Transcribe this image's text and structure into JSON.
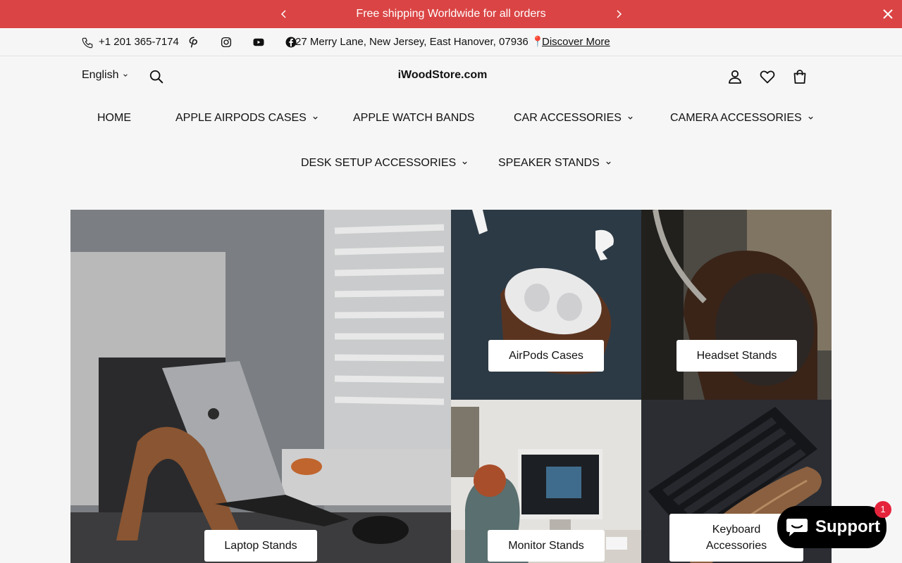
{
  "colors": {
    "announce_bg": "#db4444",
    "support_bg": "#000000",
    "badge": "#e5243b"
  },
  "announcement": {
    "text": "Free shipping Worldwide for all orders",
    "prev_icon": "chevron-left-icon",
    "next_icon": "chevron-right-icon",
    "close_icon": "close-icon"
  },
  "infobar": {
    "phone": "+1 201 365-7174",
    "socials": [
      "pinterest-icon",
      "instagram-icon",
      "youtube-icon",
      "facebook-icon"
    ],
    "address": "27 Merry Lane, New Jersey, East Hanover, 07936 📍",
    "discover_label": "Discover More"
  },
  "header": {
    "language": "English",
    "logo": "iWoodStore.com",
    "icons": [
      "account-icon",
      "wishlist-icon",
      "cart-icon"
    ]
  },
  "nav": {
    "home": "HOME",
    "airpods": "APPLE AIRPODS CASES",
    "watch": "APPLE WATCH BANDS",
    "car": "CAR ACCESSORIES",
    "camera": "CAMERA ACCESSORIES",
    "desk": "DESK SETUP ACCESSORIES",
    "speaker": "SPEAKER STANDS"
  },
  "collections": {
    "laptop": "Laptop Stands",
    "airpods": "AirPods Cases",
    "headset": "Headset Stands",
    "monitor": "Monitor Stands",
    "keyboard": "Keyboard Accessories"
  },
  "support": {
    "label": "Support",
    "badge": "1"
  }
}
